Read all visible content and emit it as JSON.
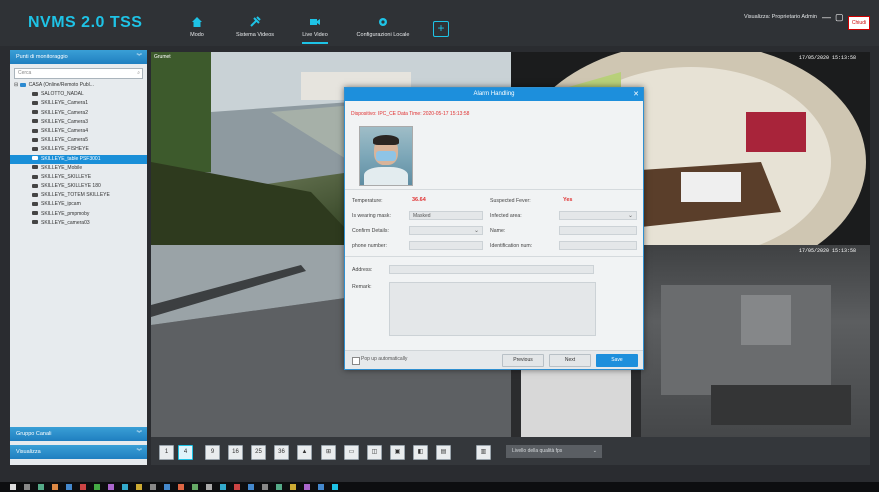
{
  "app": {
    "title": "NVMS 2.0 TSS",
    "user": "Visualizza: Proprietario Admin",
    "close_label": "Chiudi"
  },
  "nav": [
    {
      "label": "Modo"
    },
    {
      "label": "Sistema Videos"
    },
    {
      "label": "Live Video"
    },
    {
      "label": "Configurazioni Locale"
    }
  ],
  "left_panel": {
    "title": "Punti di monitoraggio",
    "search_placeholder": "Cerca",
    "tree": [
      "CASA (Online/Remoto Publ...",
      "SALOTTO_NADAL",
      "SKILLEYE_Camera1",
      "SKILLEYE_Camera2",
      "SKILLEYE_Camera3",
      "SKILLEYE_Camera4",
      "SKILLEYE_Camera5",
      "SKILLEYE_FISHEYE",
      "SKILLEYE_table PSF3001",
      "SKILLEYE_Mobile",
      "SKILLEYE_SKILLEYE",
      "SKILLEYE_SKILLEYE 180",
      "SKILLEYE_TOTEM SKILLEYE",
      "SKILLEYE_ipcam",
      "SKILLEYE_pmpmoby",
      "SKILLEYE_camera03"
    ],
    "bottom_tabs": [
      "Gruppo Canali",
      "Visualizza"
    ]
  },
  "cameras": [
    {
      "label": "Grumet",
      "time": ""
    },
    {
      "label": "",
      "time": "17/05/2020 15:13:58"
    },
    {
      "label": "",
      "time": ""
    },
    {
      "label": "",
      "time": "17/05/2020 15:13:58"
    }
  ],
  "toolbar": {
    "buttons": [
      "1",
      "4",
      "9",
      "16",
      "25",
      "36",
      "▲",
      "⊞",
      "▭",
      "◫",
      "▣",
      "◧",
      "▤",
      "▥"
    ],
    "select_label": "Livello della qualità fps"
  },
  "dialog": {
    "title": "Alarm Handling",
    "info": "Dispositivo: IPC_CE    Data Time: 2020-05-17 15:13:58",
    "fields": {
      "temperature_label": "Temperature:",
      "temperature_value": "36.64",
      "suspected_fever_label": "Suspected Fever:",
      "suspected_fever_value": "Yes",
      "wearing_mask_label": "Is wearing mask:",
      "wearing_mask_value": "Masked",
      "infected_area_label": "Infected area:",
      "infected_area_value": "",
      "confirm_details_label": "Confirm Details:",
      "confirm_details_value": "",
      "name_label": "Name:",
      "name_value": "",
      "phone_label": "phone number:",
      "phone_value": "",
      "id_label": "Identification num:",
      "id_value": "",
      "address_label": "Address:",
      "address_value": "",
      "remark_label": "Remark:",
      "remark_value": ""
    },
    "popup_label": "Pop up automatically",
    "buttons": {
      "previous": "Previous",
      "next": "Next",
      "save": "Save"
    }
  },
  "colors": {
    "accent": "#1ec3e6",
    "panel_header": "#1f7fc0",
    "selection": "#1a8fd8",
    "alert": "#e03030"
  }
}
